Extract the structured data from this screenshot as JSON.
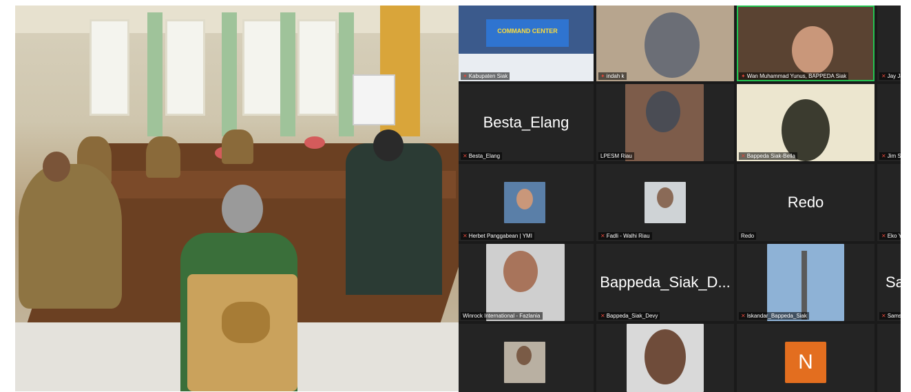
{
  "zoom": {
    "tiles": [
      {
        "label": "Kabupaten Siak",
        "banner": "COMMAND CENTER",
        "muted": false
      },
      {
        "label": "indah k",
        "muted": false
      },
      {
        "label": "Wan Muhammad Yunus, BAPPEDA Siak",
        "muted": false,
        "active": true
      },
      {
        "label": "Jay Ja",
        "muted": true
      },
      {
        "label": "Besta_Elang",
        "big_name": "Besta_Elang",
        "muted": true
      },
      {
        "label": "LPESM Riau",
        "muted": false
      },
      {
        "label": "Bappeda Siak-Bella",
        "muted": true
      },
      {
        "label": "Jim St",
        "muted": true
      },
      {
        "label": "Herbet Panggabean | YMI",
        "muted": true
      },
      {
        "label": "Fadli - Walhi Riau",
        "muted": true
      },
      {
        "label": "Redo",
        "big_name": "Redo",
        "muted": false
      },
      {
        "label": "Eko Y",
        "muted": true
      },
      {
        "label": "Winrock International - Fazlania",
        "muted": false
      },
      {
        "label": "Bappeda_Siak_Devy",
        "big_name": "Bappeda_Siak_D...",
        "muted": true
      },
      {
        "label": "Iskandar_Bappeda_Siak",
        "muted": true
      },
      {
        "label": "Samsu",
        "big_name": "Sa",
        "muted": true
      },
      {
        "label": "",
        "muted": false
      },
      {
        "label": "",
        "muted": false
      },
      {
        "label": "",
        "avatar_letter": "N",
        "muted": false
      }
    ],
    "colors": {
      "active_border": "#23c552",
      "tile_bg": "#242424",
      "grid_bg": "#1a1a1a",
      "avatar_orange": "#e36e1f"
    }
  }
}
